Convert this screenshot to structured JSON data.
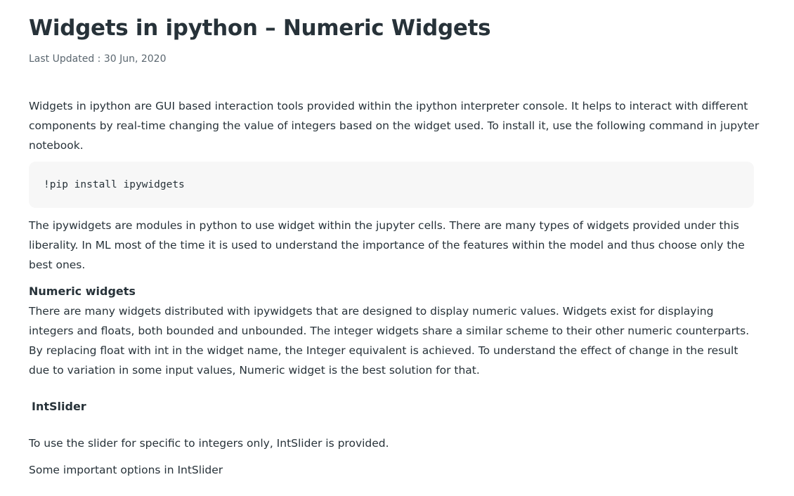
{
  "article": {
    "title": "Widgets in ipython – Numeric Widgets",
    "last_updated": "Last Updated : 30 Jun, 2020",
    "intro_paragraph": "Widgets in ipython are GUI based interaction tools provided within the ipython interpreter console. It helps to interact with different components by real-time changing the value of integers based on the widget used. To install it, use the following command in jupyter notebook.",
    "install_command": "!pip install ipywidgets",
    "ipywidgets_paragraph": "The ipywidgets are modules in python to use widget within the jupyter cells. There are many types of widgets provided under this liberality. In ML most of the time it is used to understand the importance of the features within the model and thus choose only the best ones.",
    "numeric_heading": "Numeric widgets",
    "numeric_paragraph": "There are many widgets distributed with ipywidgets that are designed to display numeric values. Widgets exist for displaying integers and floats, both bounded and unbounded. The integer widgets share a similar scheme to their other numeric counterparts. By replacing float with int in the widget name, the Integer equivalent is achieved. To understand the effect of change in the result due to variation in some input values, Numeric widget is the best solution for that.",
    "intslider_heading": "IntSlider",
    "intslider_paragraph": "To use the slider for specific to integers only, IntSlider is provided.",
    "intslider_options_intro": "Some important options in IntSlider"
  },
  "colors": {
    "text": "#273239",
    "meta_text": "#5b6770",
    "code_background": "#f7f7f7",
    "page_background": "#ffffff"
  }
}
